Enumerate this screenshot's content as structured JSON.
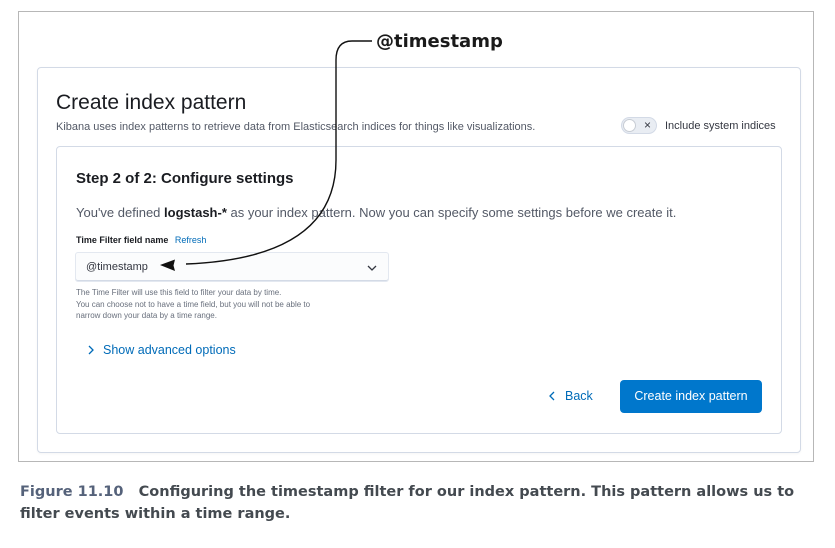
{
  "page": {
    "title": "Create index pattern",
    "description": "Kibana uses index patterns to retrieve data from Elasticsearch indices for things like visualizations.",
    "system_indices_toggle": {
      "label": "Include system indices",
      "checked": false,
      "icon": "cross-icon"
    }
  },
  "step": {
    "title": "Step 2 of 2: Configure settings",
    "desc_prefix": "You've defined ",
    "pattern_name": "logstash-*",
    "desc_suffix": " as your index pattern. Now you can specify some settings before we create it."
  },
  "time_field": {
    "label": "Time Filter field name",
    "refresh_label": "Refresh",
    "selected_value": "@timestamp",
    "help_lines": [
      "The Time Filter will use this field to filter your data by time.",
      "You can choose not to have a time field, but you will not be able to",
      "narrow down your data by a time range."
    ]
  },
  "advanced": {
    "label": "Show advanced options"
  },
  "actions": {
    "back_label": "Back",
    "create_label": "Create index pattern",
    "primary_color": "#0077cc",
    "link_color": "#006bb8"
  },
  "annotation": {
    "callout": "@timestamp"
  },
  "caption": {
    "figure_number": "Figure 11.10",
    "text": "Configuring the timestamp filter for our index pattern. This pattern allows us to filter events within a time range."
  }
}
